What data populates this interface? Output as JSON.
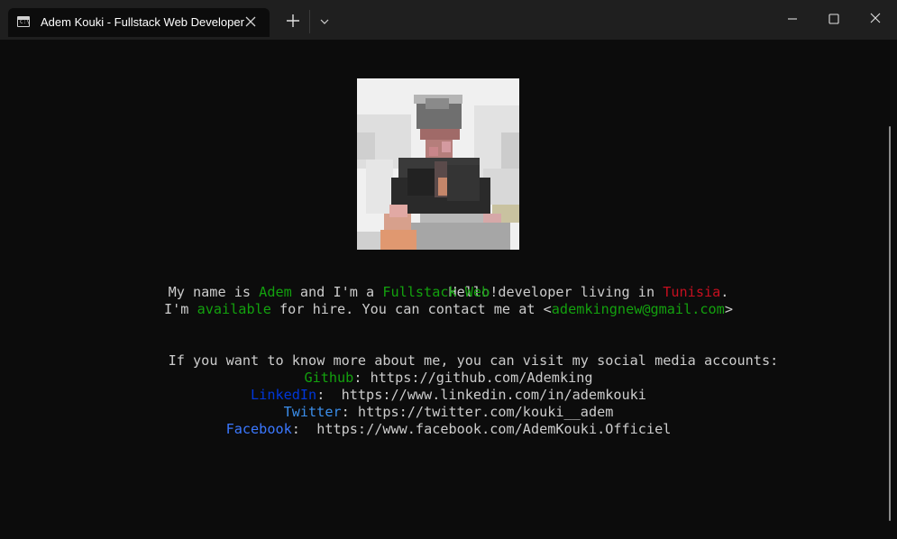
{
  "window": {
    "tab_title": "Adem Kouki - Fullstack Web Developer",
    "tab_icon": "terminal-icon",
    "controls": [
      "minimize-icon",
      "maximize-icon",
      "close-icon"
    ]
  },
  "terminal": {
    "avatar_icon": "profile-photo",
    "greeting": "Hello!",
    "line1": {
      "p1": "My name is ",
      "name": "Adem",
      "p2": " and I'm a ",
      "role": "Fullstack Web",
      "p3": " developer living in ",
      "country": "Tunisia",
      "p4": "."
    },
    "line2": {
      "p1": "I'm ",
      "available": "available",
      "p2": " for hire. You can contact me at <",
      "email": "ademkingnew@gmail.com",
      "p3": ">"
    },
    "social_intro": "If you want to know more about me, you can visit my social media accounts:",
    "social": [
      {
        "label": "Github",
        "sep": ": ",
        "url": "https://github.com/Ademking"
      },
      {
        "label": "LinkedIn",
        "sep": ":  ",
        "url": "https://www.linkedin.com/in/ademkouki"
      },
      {
        "label": "Twitter",
        "sep": ": ",
        "url": "https://twitter.com/kouki__adem"
      },
      {
        "label": "Facebook",
        "sep": ":  ",
        "url": "https://www.facebook.com/AdemKouki.Officiel"
      }
    ]
  },
  "colors": {
    "background": "#0c0c0c",
    "titlebar": "#1f1f1f",
    "text": "#cccccc",
    "green": "#13a10e",
    "red": "#c50f1f",
    "blue": "#0037da",
    "light_blue": "#3b78ff"
  }
}
